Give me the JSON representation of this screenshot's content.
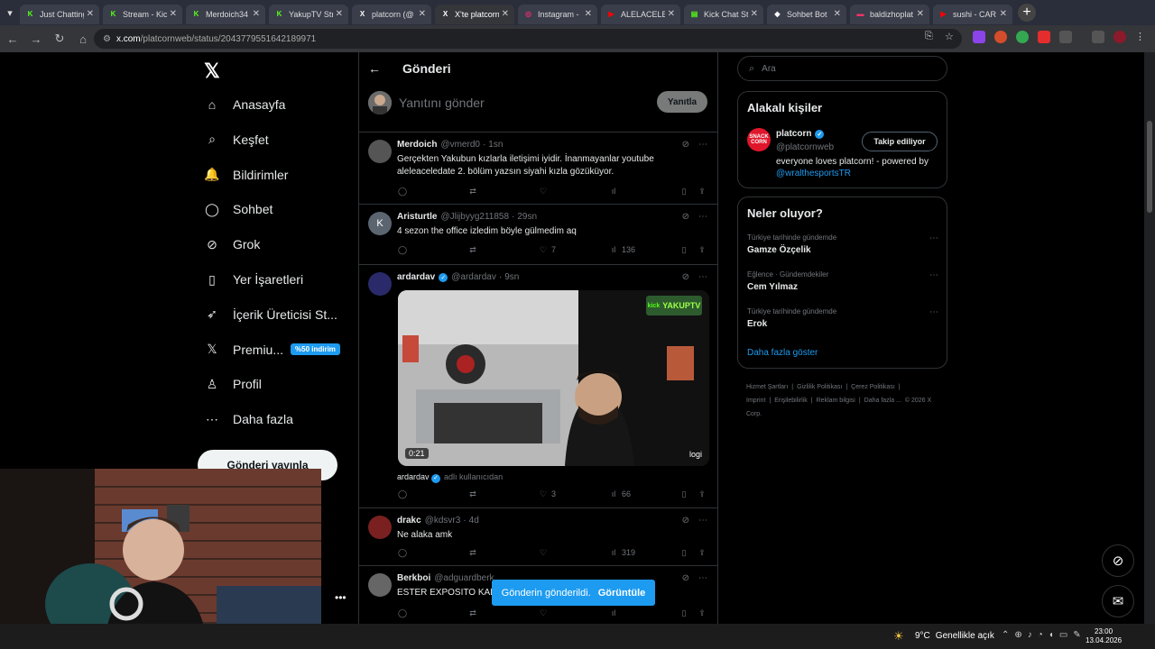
{
  "browser": {
    "tabs": [
      {
        "label": "Just Chatting",
        "fav": "K",
        "favcolor": "#53fc18"
      },
      {
        "label": "Stream - Kick",
        "fav": "K",
        "favcolor": "#53fc18"
      },
      {
        "label": "Merdoich34",
        "fav": "K",
        "favcolor": "#53fc18"
      },
      {
        "label": "YakupTV Str",
        "fav": "K",
        "favcolor": "#53fc18"
      },
      {
        "label": "platcorn (@",
        "fav": "X",
        "favcolor": "#ffffff"
      },
      {
        "label": "X'te platcorn",
        "fav": "X",
        "favcolor": "#ffffff"
      },
      {
        "label": "Instagram -",
        "fav": "◎",
        "favcolor": "#e1306c"
      },
      {
        "label": "ALELACELE",
        "fav": "▶",
        "favcolor": "#ff0000"
      },
      {
        "label": "Kick Chat St",
        "fav": "▤",
        "favcolor": "#53fc18"
      },
      {
        "label": "Sohbet Bot",
        "fav": "◆",
        "favcolor": "#ffffff"
      },
      {
        "label": "baldizhoplat",
        "fav": "▬",
        "favcolor": "#ff3366"
      },
      {
        "label": "sushi - CAR",
        "fav": "▶",
        "favcolor": "#ff0000"
      }
    ],
    "url_site": "x.com",
    "url_path": "/platcornweb/status/2043779551642189971"
  },
  "nav": {
    "items": [
      {
        "label": "Anasayfa",
        "icon": "home-icon"
      },
      {
        "label": "Keşfet",
        "icon": "search-icon"
      },
      {
        "label": "Bildirimler",
        "icon": "bell-icon"
      },
      {
        "label": "Sohbet",
        "icon": "chat-icon"
      },
      {
        "label": "Grok",
        "icon": "grok-icon"
      },
      {
        "label": "Yer İşaretleri",
        "icon": "bookmark-icon"
      },
      {
        "label": "İçerik Üreticisi St...",
        "icon": "rocket-icon"
      },
      {
        "label": "Premiu...",
        "icon": "x-logo-icon",
        "badge": "%50 indirim"
      },
      {
        "label": "Profil",
        "icon": "person-icon"
      },
      {
        "label": "Daha fazla",
        "icon": "more-circle-icon"
      }
    ],
    "post_button": "Gönderi yayınla"
  },
  "center": {
    "title": "Gönderi",
    "composer_placeholder": "Yanıtını gönder",
    "reply_button": "Yanıtla",
    "posts": [
      {
        "name": "Merdoich",
        "handle": "@vmerd0",
        "time": "1sn",
        "text": "Gerçekten Yakubun kızlarla iletişimi iyidir. İnanmayanlar youtube aleleaceledate 2. bölüm yazsın siyahi kızla gözüküyor.",
        "likes": "",
        "views": ""
      },
      {
        "name": "Aristurtle",
        "handle": "@Jlijbyyg211858",
        "time": "29sn",
        "text": "4 sezon the office izledim böyle gülmedim aq",
        "likes": "7",
        "views": "136"
      },
      {
        "name": "ardardav",
        "handle": "@ardardav",
        "time": "9sn",
        "text": "",
        "likes": "3",
        "views": "66",
        "video_duration": "0:21",
        "video_brand": "logi",
        "video_logo": "YAKUPTV",
        "video_logo_prefix": "kick",
        "attribution_name": "ardardav",
        "attribution_suffix": "adlı kullanıcıdan"
      },
      {
        "name": "drakc",
        "handle": "@kdsvr3",
        "time": "4d",
        "text": "Ne alaka amk",
        "likes": "",
        "views": "319"
      },
      {
        "name": "Berkboi",
        "handle": "@adguardberk",
        "time": "",
        "text": "ESTER EXPOSITO KALI",
        "likes": "",
        "views": ""
      }
    ]
  },
  "toast": {
    "message": "Gönderin gönderildi.",
    "action": "Görüntüle"
  },
  "right": {
    "search_placeholder": "Ara",
    "people_title": "Alakalı kişiler",
    "person": {
      "name": "platcorn",
      "handle": "@platcornweb",
      "follow_label": "Takip ediliyor",
      "bio": "everyone loves platcorn! - powered by",
      "bio_link": "@wralthesportsTR",
      "avatar_text": "SNACK CORN"
    },
    "trends_title": "Neler oluyor?",
    "trends": [
      {
        "context": "Türkiye tarihinde gündemde",
        "title": "Gamze Özçelik"
      },
      {
        "context": "Eğlence · Gündemdekiler",
        "title": "Cem Yılmaz"
      },
      {
        "context": "Türkiye tarihinde gündemde",
        "title": "Erok"
      }
    ],
    "show_more": "Daha fazla göster",
    "footer": [
      "Hizmet Şartları",
      "|",
      "Gizlilik Politikası",
      "|",
      "Çerez Politikası",
      "|",
      "Imprint",
      "|",
      "Erişilebilirlik",
      "|",
      "Reklam bilgisi",
      "|",
      "Daha fazla ...",
      "© 2026 X Corp."
    ]
  },
  "taskbar": {
    "temp": "9°C",
    "weather": "Genellikle açık",
    "time": "23:00",
    "date": "13.04.2026"
  },
  "colors": {
    "accent": "#1d9bf0",
    "bg": "#000000",
    "border": "#2f3336",
    "muted": "#71767b"
  }
}
